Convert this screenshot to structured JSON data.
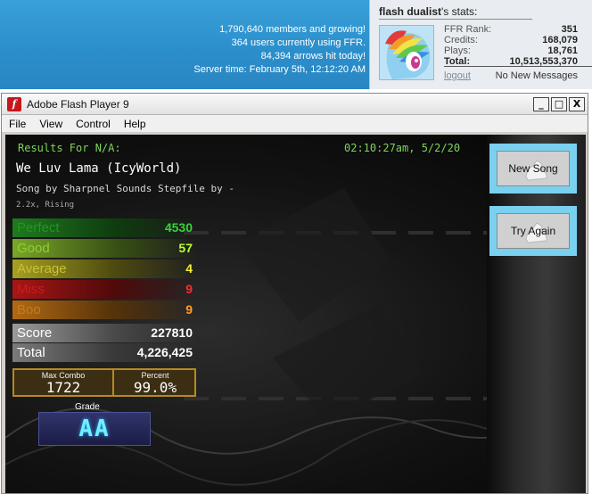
{
  "site": {
    "members_line": "1,790,640 members and growing!",
    "users_line": "364 users currently using FFR.",
    "arrows_line": "84,394 arrows hit today!",
    "server_time": "Server time: February 5th, 12:12:20 AM"
  },
  "stats": {
    "username": "flash dualist",
    "title_suffix": "'s stats:",
    "rows": [
      {
        "label": "FFR Rank:",
        "value": "351"
      },
      {
        "label": "Credits:",
        "value": "168,079"
      },
      {
        "label": "Plays:",
        "value": "18,761"
      },
      {
        "label": "Total:",
        "value": "10,513,553,370"
      }
    ],
    "logout": "logout",
    "messages": "No New Messages"
  },
  "window": {
    "title": "Adobe Flash Player 9",
    "icon": "flash-app-icon",
    "controls": {
      "minimize": "_",
      "maximize": "□",
      "close": "X"
    },
    "menu": [
      "File",
      "View",
      "Control",
      "Help"
    ]
  },
  "results": {
    "header": "Results For N/A:",
    "timestamp": "02:10:27am, 5/2/20",
    "song_title": "We Luv Lama (IcyWorld)",
    "credit": "Song by Sharpnel Sounds   Stepfile by -",
    "mods": "2.2x, Rising",
    "judgements": [
      {
        "label": "Perfect",
        "value": "4530"
      },
      {
        "label": "Good",
        "value": "57"
      },
      {
        "label": "Average",
        "value": "4"
      },
      {
        "label": "Miss",
        "value": "9"
      },
      {
        "label": "Boo",
        "value": "9"
      }
    ],
    "score_label": "Score",
    "score": "227810",
    "total_label": "Total",
    "total": "4,226,425",
    "max_combo_label": "Max Combo",
    "max_combo": "1722",
    "percent_label": "Percent",
    "percent": "99.0%",
    "grade_label": "Grade",
    "grade": "AA"
  },
  "buttons": {
    "new_song": "New Song",
    "try_again": "Try Again"
  },
  "colors": {
    "accent_green": "#7fd35a",
    "button_blue": "#7ad0ef",
    "grade_cyan": "#6ef0ff",
    "site_blue": "#2b8fcc"
  }
}
